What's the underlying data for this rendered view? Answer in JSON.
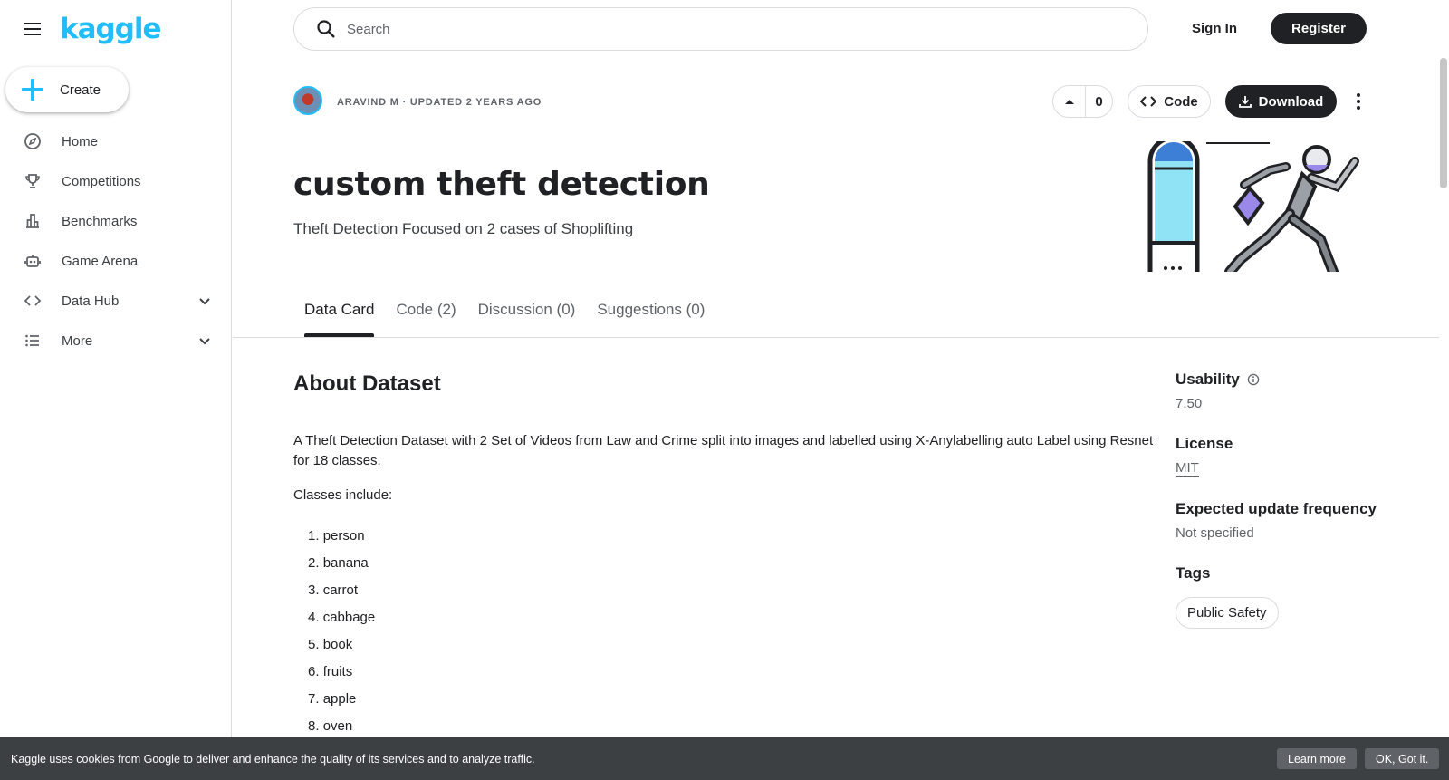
{
  "brand": {
    "logo_text": "kaggle",
    "accent": "#20beff"
  },
  "sidebar": {
    "create_label": "Create",
    "items": [
      {
        "label": "Home",
        "icon": "compass-icon"
      },
      {
        "label": "Competitions",
        "icon": "trophy-icon"
      },
      {
        "label": "Benchmarks",
        "icon": "bar-chart-icon"
      },
      {
        "label": "Game Arena",
        "icon": "robot-icon"
      },
      {
        "label": "Data Hub",
        "icon": "code-icon",
        "expandable": true
      },
      {
        "label": "More",
        "icon": "list-icon",
        "expandable": true
      }
    ]
  },
  "header": {
    "search_placeholder": "Search",
    "sign_in": "Sign In",
    "register": "Register"
  },
  "dataset": {
    "meta": "ARAVIND M · UPDATED 2 YEARS AGO",
    "votes": "0",
    "code_label": "Code",
    "download_label": "Download",
    "title": "custom theft detection",
    "subtitle": "Theft Detection Focused on 2 cases of Shoplifting"
  },
  "tabs": [
    {
      "label": "Data Card",
      "active": true
    },
    {
      "label": "Code (2)",
      "active": false
    },
    {
      "label": "Discussion (0)",
      "active": false
    },
    {
      "label": "Suggestions (0)",
      "active": false
    }
  ],
  "about": {
    "heading": "About Dataset",
    "description": "A Theft Detection Dataset with 2 Set of Videos from Law and Crime split into images and labelled using X-Anylabelling auto Label using Resnet for 18 classes.",
    "classes_label": "Classes include:",
    "classes": [
      "person",
      "banana",
      "carrot",
      "cabbage",
      "book",
      "fruits",
      "apple",
      "oven"
    ]
  },
  "info": {
    "usability_label": "Usability",
    "usability_value": "7.50",
    "license_label": "License",
    "license_value": "MIT",
    "update_label": "Expected update frequency",
    "update_value": "Not specified",
    "tags_label": "Tags",
    "tags": [
      "Public Safety"
    ]
  },
  "cookie": {
    "message": "Kaggle uses cookies from Google to deliver and enhance the quality of its services and to analyze traffic.",
    "learn_more": "Learn more",
    "ok": "OK, Got it."
  }
}
